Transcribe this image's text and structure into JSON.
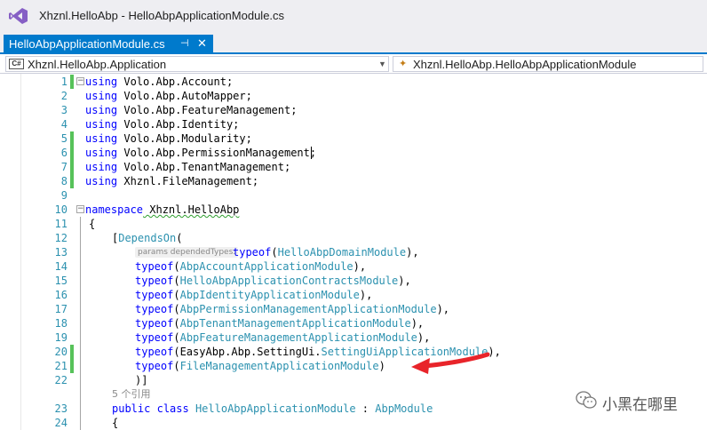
{
  "window": {
    "title": "Xhznl.HelloAbp - HelloAbpApplicationModule.cs"
  },
  "tab": {
    "label": "HelloAbpApplicationModule.cs",
    "pin_glyph": "⊣",
    "close_glyph": "✕"
  },
  "navbar": {
    "project_icon_text": "C#",
    "project": "Xhznl.HelloAbp.Application",
    "type": "Xhznl.HelloAbp.HelloAbpApplicationModule",
    "type_icon": "class-icon"
  },
  "editor": {
    "lines": [
      {
        "n": "1",
        "p1": "using",
        "p2": " Volo.Abp.Account;"
      },
      {
        "n": "2",
        "p1": "using",
        "p2": " Volo.Abp.AutoMapper;"
      },
      {
        "n": "3",
        "p1": "using",
        "p2": " Volo.Abp.FeatureManagement;"
      },
      {
        "n": "4",
        "p1": "using",
        "p2": " Volo.Abp.Identity;"
      },
      {
        "n": "5",
        "p1": "using",
        "p2": " Volo.Abp.Modularity;"
      },
      {
        "n": "6",
        "p1": "using",
        "p2": " Volo.Abp.PermissionManagement;"
      },
      {
        "n": "7",
        "p1": "using",
        "p2": " Volo.Abp.TenantManagement;"
      },
      {
        "n": "8",
        "p1": "using",
        "p2": " Xhznl.FileManagement;"
      },
      {
        "n": "9",
        "p1": "",
        "p2": ""
      },
      {
        "n": "10",
        "p1": "namespace",
        "p2": " Xhznl.HelloAbp"
      },
      {
        "n": "11",
        "p1": "{",
        "p2": ""
      },
      {
        "n": "12",
        "p1": "[",
        "p2": "DependsOn",
        "p3": "("
      },
      {
        "n": "13",
        "hint": "params dependedTypes:",
        "p1": "typeof",
        "p2": "(",
        "p3": "HelloAbpDomainModule",
        "p4": "),"
      },
      {
        "n": "14",
        "p1": "typeof",
        "p2": "(",
        "p3": "AbpAccountApplicationModule",
        "p4": "),"
      },
      {
        "n": "15",
        "p1": "typeof",
        "p2": "(",
        "p3": "HelloAbpApplicationContractsModule",
        "p4": "),"
      },
      {
        "n": "16",
        "p1": "typeof",
        "p2": "(",
        "p3": "AbpIdentityApplicationModule",
        "p4": "),"
      },
      {
        "n": "17",
        "p1": "typeof",
        "p2": "(",
        "p3": "AbpPermissionManagementApplicationModule",
        "p4": "),"
      },
      {
        "n": "18",
        "p1": "typeof",
        "p2": "(",
        "p3": "AbpTenantManagementApplicationModule",
        "p4": "),"
      },
      {
        "n": "19",
        "p1": "typeof",
        "p2": "(",
        "p3": "AbpFeatureManagementApplicationModule",
        "p4": "),"
      },
      {
        "n": "20",
        "p1": "typeof",
        "p2": "(EasyAbp.Abp.SettingUi.",
        "p3": "SettingUiApplicationModule",
        "p4": "),"
      },
      {
        "n": "21",
        "p1": "typeof",
        "p2": "(",
        "p3": "FileManagementApplicationModule",
        "p4": ")"
      },
      {
        "n": "22",
        "p1": ")]",
        "p2": ""
      },
      {
        "n": "",
        "p1": "5 个引用",
        "p2": ""
      },
      {
        "n": "23",
        "p1": "public",
        "p2": " ",
        "p3": "class",
        "p4": " ",
        "p5": "HelloAbpApplicationModule",
        "p6": " : ",
        "p7": "AbpModule"
      },
      {
        "n": "24",
        "p1": "{",
        "p2": ""
      }
    ]
  },
  "watermark": {
    "text": "小黑在哪里",
    "icon": "wechat-icon"
  },
  "colors": {
    "accent": "#007acc",
    "keyword": "#0000ff",
    "type": "#2b91af",
    "line_number": "#2b91af",
    "change_marker": "#57c25a",
    "annotation_arrow": "#e8242a"
  }
}
